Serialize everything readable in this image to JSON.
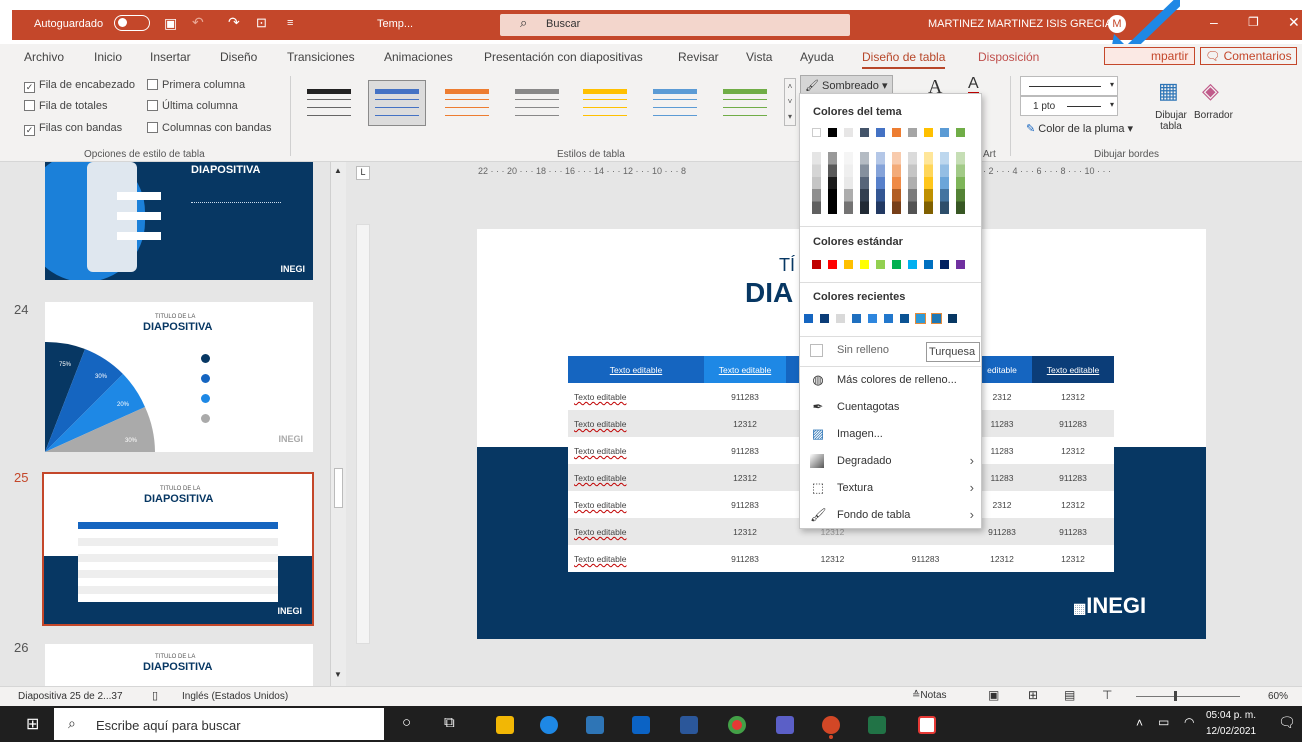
{
  "titlebar": {
    "autosave": "Autoguardado",
    "file_name": "Temp...",
    "search_placeholder": "Buscar",
    "user": "MARTINEZ MARTINEZ ISIS GRECIA",
    "user_initials": "M"
  },
  "menu": [
    "Archivo",
    "Inicio",
    "Insertar",
    "Diseño",
    "Transiciones",
    "Animaciones",
    "Presentación con diapositivas",
    "Revisar",
    "Vista",
    "Ayuda",
    "Diseño de tabla",
    "Disposición"
  ],
  "active_menu": "Diseño de tabla",
  "share": "mpartir",
  "comments": "Comentarios",
  "style_options": {
    "fila_encabezado": "Fila de encabezado",
    "primera_columna": "Primera columna",
    "fila_totales": "Fila de totales",
    "ultima_columna": "Última columna",
    "filas_bandas": "Filas con bandas",
    "columnas_bandas": "Columnas con bandas",
    "group": "Opciones de estilo de tabla"
  },
  "table_styles_group": "Estilos de tabla",
  "shading_button": "Sombreado",
  "wordart_group": "Art",
  "borders": {
    "weight": "1 pto",
    "pen_color": "Color de la pluma",
    "draw": "Dibujar tabla",
    "eraser": "Borrador",
    "group": "Dibujar bordes"
  },
  "ruler_text": "22 · · · 20 · · · 18 · · · 16 · · · 14 · · · 12 · · · 10 · · · 8",
  "ruler_text_right": "· 2 · · · 4 · · · 6 · · · 8 · · · 10 · · ·",
  "dropdown": {
    "theme_colors": "Colores del tema",
    "standard_colors": "Colores estándar",
    "recent_colors": "Colores recientes",
    "no_fill": "Sin relleno",
    "more_colors": "Más colores de relleno...",
    "eyedropper": "Cuentagotas",
    "image": "Imagen...",
    "gradient": "Degradado",
    "texture": "Textura",
    "table_bg": "Fondo de tabla",
    "tooltip": "Turquesa"
  },
  "colors": {
    "theme_top": [
      "#ffffff",
      "#000000",
      "#e7e6e6",
      "#44546a",
      "#4472c4",
      "#ed7d31",
      "#a5a5a5",
      "#ffc000",
      "#5b9bd5",
      "#70ad47"
    ],
    "standard": [
      "#c00000",
      "#ff0000",
      "#ffc000",
      "#ffff00",
      "#92d050",
      "#00b050",
      "#00b0f0",
      "#0070c0",
      "#002060",
      "#7030a0"
    ],
    "recent": [
      "#1565c0",
      "#0b3d78",
      "#d9d9d9",
      "#1f6fbf",
      "#2e86de",
      "#2277cc",
      "#0b5394",
      "#2e9ad8",
      "#1f77b4",
      "#073763"
    ],
    "navy": "#073763",
    "accent": "#1976d2"
  },
  "slide": {
    "title_small": "TÍ",
    "title_big": "DIA",
    "logo": "INEGI",
    "header": [
      "Texto editable",
      "Texto editable",
      "editable",
      "Texto editable"
    ],
    "rows": [
      [
        "Texto editable",
        "911283",
        "2312",
        "12312"
      ],
      [
        "Texto editable",
        "12312",
        "11283",
        "911283"
      ],
      [
        "Texto editable",
        "911283",
        "11283",
        "12312"
      ],
      [
        "Texto editable",
        "12312",
        "11283",
        "911283"
      ],
      [
        "Texto editable",
        "911283",
        "2312",
        "12312"
      ],
      [
        "Texto editable",
        "12312",
        "911283",
        "911283"
      ],
      [
        "Texto editable",
        "911283",
        "12312",
        "12312"
      ]
    ],
    "row6_mid": "12312",
    "row7_mid": "12312",
    "row7_mid2": "911283"
  },
  "thumbs": {
    "n24": "24",
    "n25": "25",
    "n26": "26",
    "t_small": "TITULO DE LA",
    "t_big": "DIAPOSITIVA",
    "logo": "INEGI",
    "slide23_title": "DIAPOSITIVA",
    "pie_labels": [
      "75%",
      "30%",
      "20%",
      "30%"
    ]
  },
  "status": {
    "slide": "Diapositiva 25 de 2...37",
    "lang": "Inglés (Estados Unidos)",
    "notes": "Notas",
    "zoom": "60%"
  },
  "taskbar": {
    "search": "Escribe aquí para buscar",
    "time": "05:04 p. m.",
    "date": "12/02/2021"
  }
}
